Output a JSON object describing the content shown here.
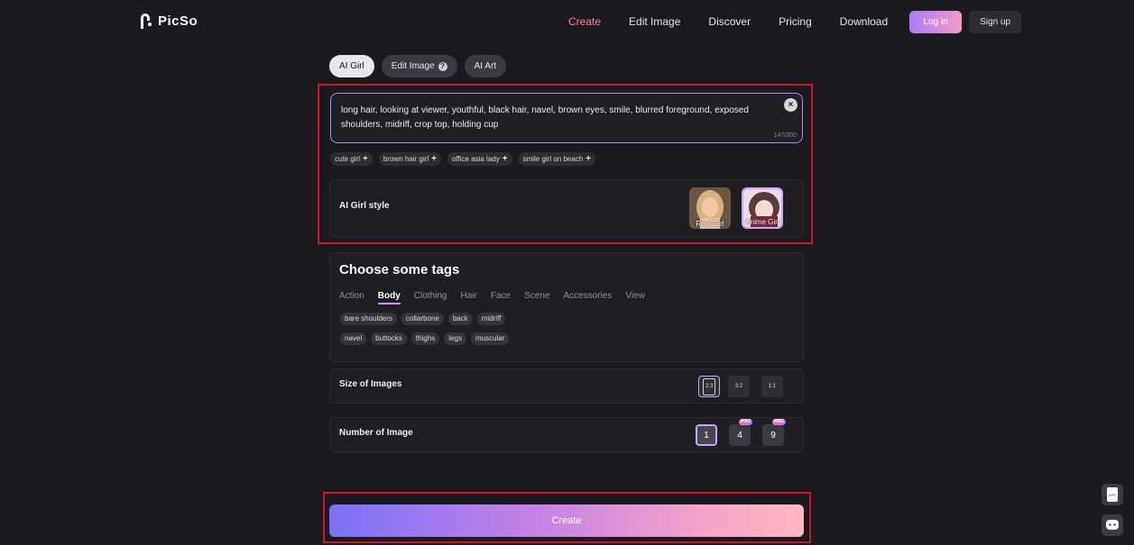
{
  "brand": {
    "name": "PicSo"
  },
  "nav": {
    "links": [
      "Create",
      "Edit Image",
      "Discover",
      "Pricing",
      "Download"
    ],
    "login": "Log in",
    "signup": "Sign up"
  },
  "mode_tabs": [
    "AI Girl",
    "Edit Image",
    "AI Art"
  ],
  "help_glyph": "?",
  "prompt": {
    "text": "long hair, looking at viewer, youthful, black hair, navel, brown eyes, smile, blurred foreground, exposed shoulders, midriff, crop top, holding cup",
    "count": "147/300",
    "clear_glyph": "×"
  },
  "suggestions": [
    "cute girl",
    "brown hair girl",
    "office asia lady",
    "smile girl on beach"
  ],
  "plus_glyph": "+",
  "style": {
    "label": "AI Girl style",
    "options": [
      "Real Girl",
      "Anime Girl"
    ],
    "selected": "Anime Girl"
  },
  "tags": {
    "title": "Choose some tags",
    "tabs": [
      "Action",
      "Body",
      "Clothing",
      "Hair",
      "Face",
      "Scene",
      "Accessories",
      "View"
    ],
    "active_tab": "Body",
    "row1": [
      "bare shoulders",
      "collarbone",
      "back",
      "midriff"
    ],
    "row2": [
      "navel",
      "buttocks",
      "thighs",
      "legs",
      "muscular"
    ]
  },
  "size": {
    "label": "Size of Images",
    "options": [
      "2:3",
      "3:2",
      "1:1"
    ],
    "selected": "2:3"
  },
  "number": {
    "label": "Number of Image",
    "options": [
      "1",
      "4",
      "9"
    ],
    "selected": "1",
    "pro_badge": "PRO"
  },
  "create_button": "Create",
  "side_buttons": [
    "app-download-icon",
    "chat-icon"
  ],
  "app_label": "APP",
  "colors": {
    "background": "#1b1b1f",
    "accent_pink": "#ff7a9c",
    "highlight_red": "#d3142a",
    "selected_border": "#c9a4ff"
  }
}
